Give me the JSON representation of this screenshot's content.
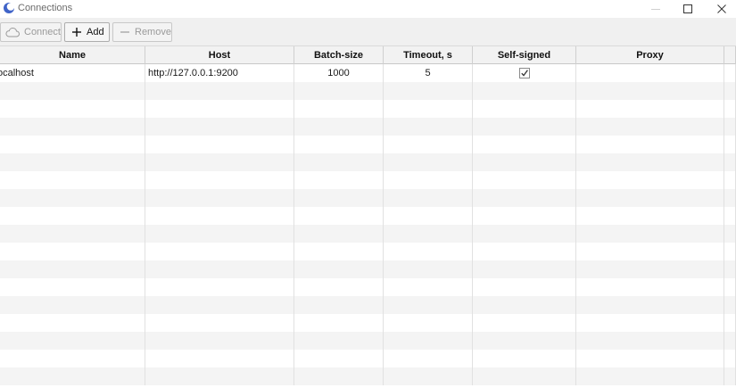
{
  "window": {
    "title": "Connections"
  },
  "toolbar": {
    "connect_label": "Connect",
    "add_label": "Add",
    "remove_label": "Remove"
  },
  "table": {
    "columns": [
      "Name",
      "Host",
      "Batch-size",
      "Timeout, s",
      "Self-signed",
      "Proxy"
    ],
    "rows": [
      {
        "name": "ocalhost",
        "host": "http://127.0.0.1:9200",
        "batch_size": "1000",
        "timeout": "5",
        "self_signed": true,
        "proxy": ""
      }
    ]
  },
  "colors": {
    "accent_icon": "#3f63c8",
    "header_bg": "#f2f2f2",
    "stripe_bg": "#f4f4f4",
    "toolbar_bg": "#f0f0f0"
  },
  "icons": {
    "app": "app-logo-icon",
    "minimize": "minimize-icon",
    "maximize": "maximize-icon",
    "close": "close-icon",
    "connect": "cloud-icon",
    "add": "plus-icon",
    "remove": "minus-icon",
    "checkbox": "check-icon"
  }
}
